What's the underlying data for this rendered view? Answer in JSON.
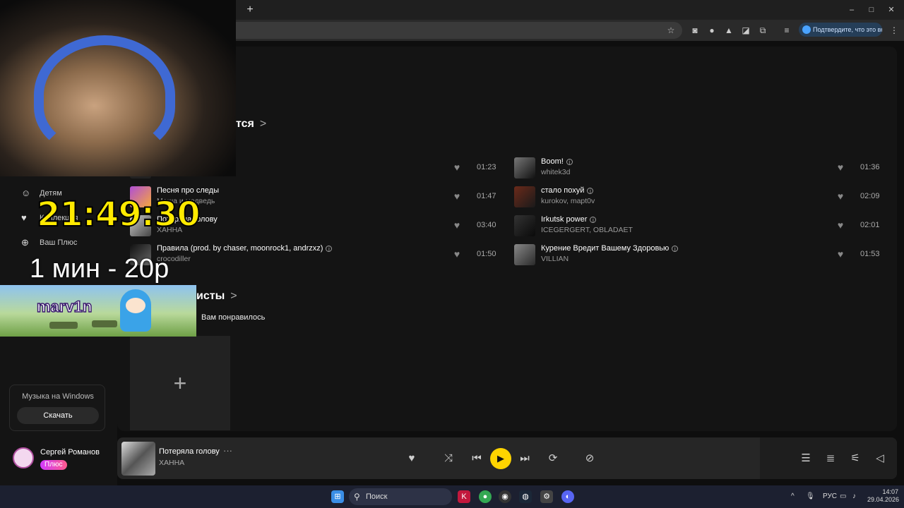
{
  "browser": {
    "newtab_label": "+",
    "window_buttons": [
      "–",
      "□",
      "✕"
    ],
    "verify_label": "Подтвердите, что это вы"
  },
  "sections": {
    "liked_title": "тся",
    "artists_title": "исты",
    "artists_subtitle": "Вам понравилось"
  },
  "tracks_left": [
    {
      "title": "",
      "artist": "",
      "duration": "01:23"
    },
    {
      "title": "Песня про следы",
      "artist": "Маша и медведь",
      "duration": "01:47"
    },
    {
      "title": "Потеряла голову",
      "artist": "ХАННА",
      "duration": "03:40"
    },
    {
      "title": "Правила (prod. by chaser, moonrock1, andrzxz)",
      "artist": "crocodiller",
      "duration": "01:50"
    }
  ],
  "tracks_right": [
    {
      "title": "Boom!",
      "artist": "whitek3d",
      "duration": "01:36"
    },
    {
      "title": "стало похуй",
      "artist": "kurokov, mapt0v",
      "duration": "02:09"
    },
    {
      "title": "Irkutsk power",
      "artist": "ICEGERGERT, OBLADAET",
      "duration": "02:01"
    },
    {
      "title": "Курение Вредит Вашему Здоровью",
      "artist": "VILLIAN",
      "duration": "01:53"
    }
  ],
  "sidebar": {
    "items": [
      {
        "label": "Детям",
        "icon": "kids-icon"
      },
      {
        "label": "Коллекция",
        "icon": "heart-icon"
      },
      {
        "label": "Ваш Плюс",
        "icon": "plus-circle-icon"
      }
    ],
    "promo_text": "Музыка на Windows",
    "promo_button": "Скачать"
  },
  "user": {
    "name": "Сергей Романов",
    "badge": "Плюс"
  },
  "player": {
    "title": "Потеряла голову",
    "artist": "ХАННА",
    "more": "···"
  },
  "overlay": {
    "clock": "21:49:30",
    "price": "1 мин - 20р",
    "banner_name": "marv1n"
  },
  "taskbar": {
    "search_label": "Поиск",
    "lang": "РУС",
    "time": "14:07",
    "date": "29.04.2026"
  },
  "colors": {
    "accent_yellow": "#ffd400",
    "background": "#0e0e0e",
    "panel": "#141414"
  }
}
